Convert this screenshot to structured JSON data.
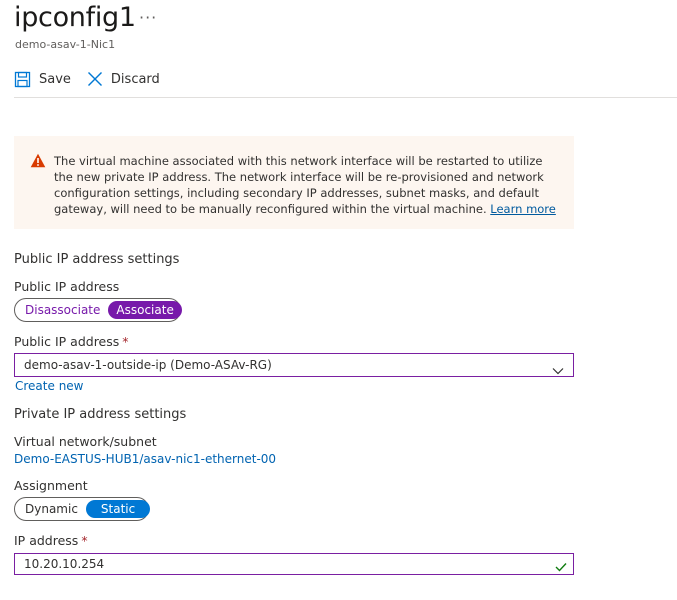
{
  "header": {
    "title": "ipconfig1",
    "more": "···",
    "subtitle": "demo-asav-1-Nic1"
  },
  "toolbar": {
    "save_label": "Save",
    "discard_label": "Discard"
  },
  "warning": {
    "text": "The virtual machine associated with this network interface will be restarted to utilize the new private IP address. The network interface will be re-provisioned and network configuration settings, including secondary IP addresses, subnet masks, and default gateway, will need to be manually reconfigured within the virtual machine.",
    "link": "Learn more"
  },
  "public_ip": {
    "section_title": "Public IP address settings",
    "toggle_label": "Public IP address",
    "options": [
      "Disassociate",
      "Associate"
    ],
    "selected": "Associate",
    "select_label": "Public IP address",
    "required_mark": "*",
    "select_value": "demo-asav-1-outside-ip (Demo-ASAv-RG)",
    "create_new": "Create new"
  },
  "private_ip": {
    "section_title": "Private IP address settings",
    "vnet_label": "Virtual network/subnet",
    "vnet_value": "Demo-EASTUS-HUB1/asav-nic1-ethernet-00",
    "assignment_label": "Assignment",
    "options": [
      "Dynamic",
      "Static"
    ],
    "selected": "Static",
    "ip_label": "IP address",
    "required_mark": "*",
    "ip_value": "10.20.10.254"
  },
  "colors": {
    "accent_purple": "#7719aa",
    "accent_blue": "#0078d4",
    "warning_bg": "#fdf6f0",
    "warning_icon": "#d83b01",
    "link": "#0063b1"
  }
}
